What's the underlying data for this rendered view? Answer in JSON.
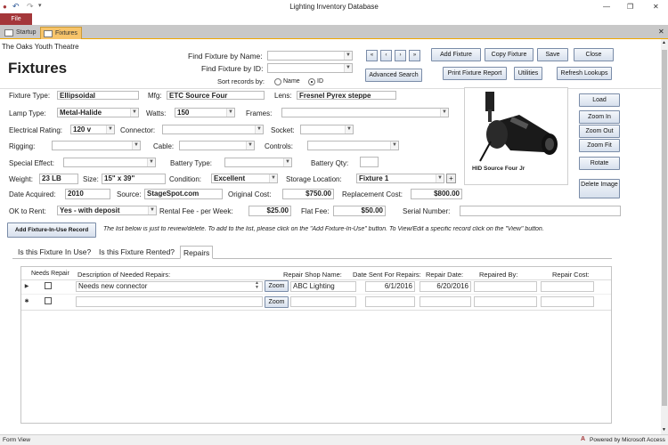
{
  "window": {
    "title": "Lighting Inventory Database",
    "controls": {
      "minimize": "—",
      "restore": "❐",
      "close": "✕"
    }
  },
  "ribbon": {
    "file_tab": "File"
  },
  "tabs": [
    {
      "label": "Startup",
      "active": false
    },
    {
      "label": "Fixtures",
      "active": true
    }
  ],
  "header": {
    "org": "The Oaks Youth Theatre",
    "title": "Fixtures",
    "find_by_name_label": "Find Fixture by Name:",
    "find_by_name_value": "",
    "find_by_id_label": "Find Fixture by ID:",
    "find_by_id_value": "",
    "sort_label": "Sort records by:",
    "sort_options": [
      "Name",
      "ID"
    ],
    "sort_selected": "ID",
    "nav": [
      "«",
      "‹",
      "›",
      "»"
    ],
    "advanced_search": "Advanced Search",
    "buttons": {
      "add_fixture": "Add Fixture",
      "copy_fixture": "Copy Fixture",
      "save": "Save",
      "close": "Close",
      "print_report": "Print Fixture Report",
      "utilities": "Utilities",
      "refresh_lookups": "Refresh Lookups"
    }
  },
  "fields": {
    "fixture_type": {
      "label": "Fixture Type:",
      "value": "Ellipsoidal"
    },
    "mfg": {
      "label": "Mfg:",
      "value": "ETC Source Four"
    },
    "lens": {
      "label": "Lens:",
      "value": "Fresnel Pyrex steppe"
    },
    "lamp_type": {
      "label": "Lamp Type:",
      "value": "Metal-Halide"
    },
    "watts": {
      "label": "Watts:",
      "value": "150"
    },
    "frames": {
      "label": "Frames:",
      "value": ""
    },
    "electrical_rating": {
      "label": "Electrical Rating:",
      "value": "120 v"
    },
    "connector": {
      "label": "Connector:",
      "value": ""
    },
    "socket": {
      "label": "Socket:",
      "value": ""
    },
    "rigging": {
      "label": "Rigging:",
      "value": ""
    },
    "cable": {
      "label": "Cable:",
      "value": ""
    },
    "controls": {
      "label": "Controls:",
      "value": ""
    },
    "special_effect": {
      "label": "Special Effect:",
      "value": ""
    },
    "battery_type": {
      "label": "Battery Type:",
      "value": ""
    },
    "battery_qty": {
      "label": "Battery Qty:",
      "value": ""
    },
    "weight": {
      "label": "Weight:",
      "value": "23 LB"
    },
    "size": {
      "label": "Size:",
      "value": "15\" x 39\""
    },
    "condition": {
      "label": "Condition:",
      "value": "Excellent"
    },
    "storage_location": {
      "label": "Storage Location:",
      "value": "Fixture 1"
    },
    "date_acquired": {
      "label": "Date Acquired:",
      "value": "2010"
    },
    "source": {
      "label": "Source:",
      "value": "StageSpot.com"
    },
    "original_cost": {
      "label": "Original Cost:",
      "value": "$750.00"
    },
    "replacement_cost": {
      "label": "Replacement Cost:",
      "value": "$800.00"
    },
    "ok_to_rent": {
      "label": "OK to Rent:",
      "value": "Yes - with deposit"
    },
    "rental_fee": {
      "label": "Rental Fee - per Week:",
      "value": "$25.00"
    },
    "flat_fee": {
      "label": "Flat Fee:",
      "value": "$50.00"
    },
    "serial_number": {
      "label": "Serial Number:",
      "value": ""
    }
  },
  "photo": {
    "caption": "HID Source Four Jr"
  },
  "photo_buttons": [
    "Load",
    "Zoom In",
    "Zoom Out",
    "Zoom Fit",
    "Rotate",
    "Delete Image"
  ],
  "add_in_use_button": "Add Fixture-In-Use Record",
  "instructions": "The list below is just to review/delete. To add to the list, please click on the \"Add Fixture-In-Use\" button.  To View/Edit a specific record click on the \"View\" button.",
  "subtabs": [
    {
      "label": "Is this Fixture In Use?",
      "active": false
    },
    {
      "label": "Is this Fixture Rented?",
      "active": false
    },
    {
      "label": "Repairs",
      "active": true
    }
  ],
  "repairs": {
    "columns": [
      "Needs Repair",
      "Description of Needed Repairs:",
      "Repair Shop Name:",
      "Date Sent For Repairs:",
      "Repair Date:",
      "Repaired By:",
      "Repair Cost:"
    ],
    "zoom_label": "Zoom",
    "rows": [
      {
        "selector": "▶",
        "needs_repair": false,
        "description": "Needs new connector",
        "shop": "ABC Lighting",
        "date_sent": "6/1/2016",
        "repair_date": "6/20/2016",
        "repaired_by": "",
        "cost": ""
      },
      {
        "selector": "✱",
        "needs_repair": false,
        "description": "",
        "shop": "",
        "date_sent": "",
        "repair_date": "",
        "repaired_by": "",
        "cost": ""
      }
    ]
  },
  "status": {
    "left": "Form View",
    "right": "Powered by Microsoft Access"
  }
}
